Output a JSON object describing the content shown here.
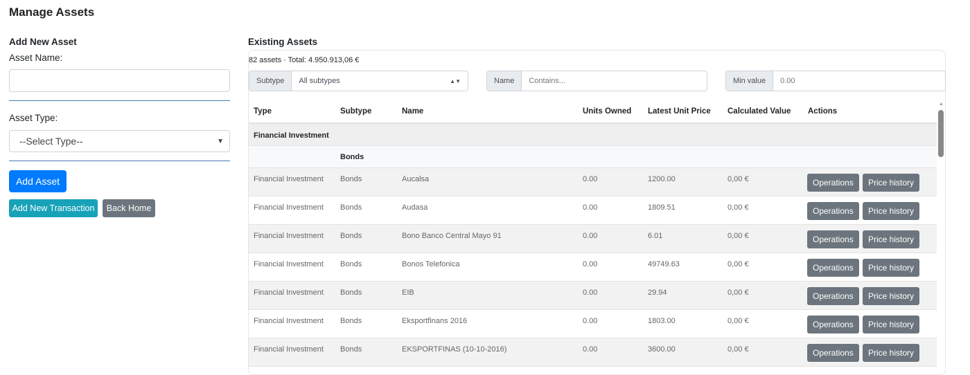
{
  "title": "Manage Assets",
  "left": {
    "heading": "Add New Asset",
    "name_label": "Asset Name:",
    "name_value": "",
    "type_label": "Asset Type:",
    "type_selected": "--Select Type--",
    "add_asset": "Add Asset",
    "add_transaction": "Add New Transaction",
    "back_home": "Back Home"
  },
  "right": {
    "heading": "Existing Assets",
    "summary": "82 assets · Total: 4.950.913,06 €",
    "filters": {
      "subtype_label": "Subtype",
      "subtype_value": "All subtypes",
      "name_label": "Name",
      "name_placeholder": "Contains...",
      "min_label": "Min value",
      "min_value": "0.00"
    },
    "columns": [
      "Type",
      "Subtype",
      "Name",
      "Units Owned",
      "Latest Unit Price",
      "Calculated Value",
      "Actions"
    ],
    "group": "Financial Investment",
    "subgroup": "Bonds",
    "rows": [
      {
        "type": "Financial Investment",
        "subtype": "Bonds",
        "name": "Aucalsa",
        "units": "0.00",
        "price": "1200.00",
        "value": "0,00 €"
      },
      {
        "type": "Financial Investment",
        "subtype": "Bonds",
        "name": "Audasa",
        "units": "0.00",
        "price": "1809.51",
        "value": "0,00 €"
      },
      {
        "type": "Financial Investment",
        "subtype": "Bonds",
        "name": "Bono Banco Central Mayo 91",
        "units": "0.00",
        "price": "6.01",
        "value": "0,00 €"
      },
      {
        "type": "Financial Investment",
        "subtype": "Bonds",
        "name": "Bonos Telefonica",
        "units": "0.00",
        "price": "49749.63",
        "value": "0,00 €"
      },
      {
        "type": "Financial Investment",
        "subtype": "Bonds",
        "name": "EIB",
        "units": "0.00",
        "price": "29.94",
        "value": "0,00 €"
      },
      {
        "type": "Financial Investment",
        "subtype": "Bonds",
        "name": "Eksportfinans 2016",
        "units": "0.00",
        "price": "1803.00",
        "value": "0,00 €"
      },
      {
        "type": "Financial Investment",
        "subtype": "Bonds",
        "name": "EKSPORTFINAS (10-10-2016)",
        "units": "0.00",
        "price": "3600.00",
        "value": "0,00 €"
      }
    ],
    "operations": "Operations",
    "price_history": "Price history"
  }
}
